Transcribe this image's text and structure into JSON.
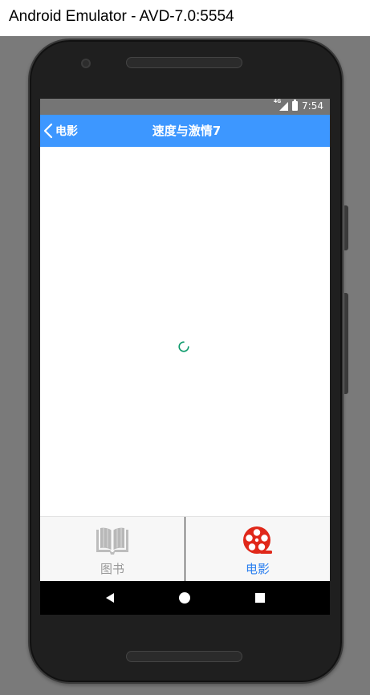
{
  "window": {
    "title": "Android Emulator - AVD-7.0:5554"
  },
  "status_bar": {
    "network": "4G",
    "time": "7:54"
  },
  "app_bar": {
    "back_label": "电影",
    "title": "速度与激情7"
  },
  "bottom_nav": {
    "items": [
      {
        "label": "图书",
        "icon": "book-icon",
        "active": false
      },
      {
        "label": "电影",
        "icon": "film-reel-icon",
        "active": true
      }
    ]
  },
  "colors": {
    "app_bar": "#3d97ff",
    "active_tab": "#2a7ff0",
    "film_icon": "#e0281a",
    "inactive_tab": "#9a9a9a",
    "spinner": "#0c9a6b"
  }
}
